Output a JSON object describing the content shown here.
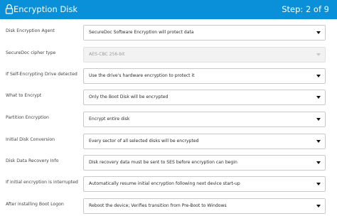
{
  "header": {
    "title": "Encryption Disk",
    "step": "Step: 2 of 9"
  },
  "rows": [
    {
      "label": "Disk Encryption Agent",
      "value": "SecureDoc Software Encryption will protect data"
    },
    {
      "label": "SecureDoc cipher type",
      "value": "AES-CBC 256-bit"
    },
    {
      "label": "If Self-Encrypting Drive detected",
      "value": "Use the drive's hardware encryption to protect it"
    },
    {
      "label": "What to Encrypt",
      "value": "Only the Boot Disk will be encrypted"
    },
    {
      "label": "Partition Encryption",
      "value": "Encrypt entire disk"
    },
    {
      "label": "Initial Disk Conversion",
      "value": "Every sector of all selected disks will be encrypted"
    },
    {
      "label": "Disk Data Recovery Info",
      "value": "Disk recovery data must be sent to SES before encryption can begin"
    },
    {
      "label": "If initial encryption is interrupted",
      "value": "Automatically resume initial encryption following next device start-up"
    },
    {
      "label": "After installing Boot Logon",
      "value": "Reboot the device; Verifies transition from Pre-Boot to Windows"
    }
  ]
}
